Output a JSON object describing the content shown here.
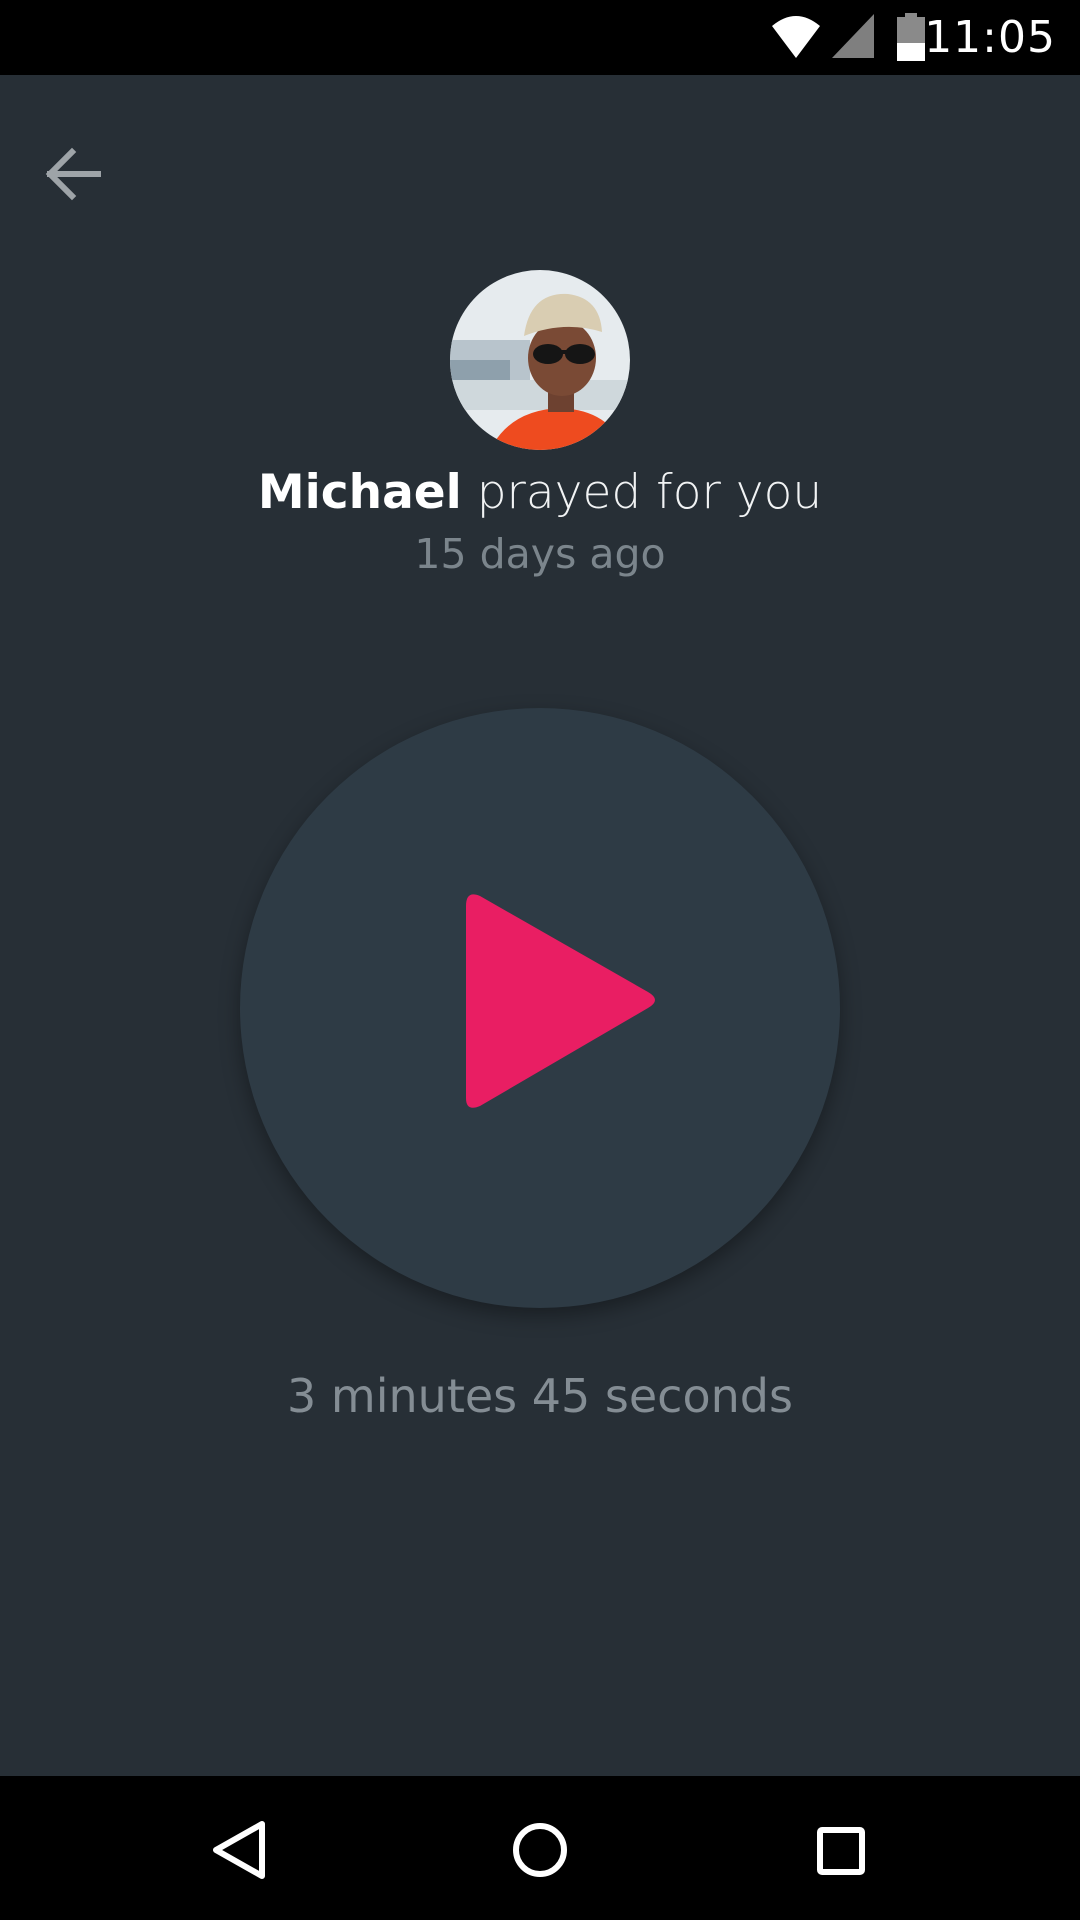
{
  "status_bar": {
    "time": "11:05",
    "icons": [
      "wifi-icon",
      "signal-icon",
      "battery-icon"
    ]
  },
  "toolbar": {
    "back_icon": "arrow-left-icon"
  },
  "prayer": {
    "name": "Michael",
    "action": " prayed for you",
    "time_ago": "15 days ago",
    "duration": "3 minutes 45 seconds"
  },
  "player": {
    "play_icon": "play-icon",
    "accent_color": "#e91e63"
  },
  "nav_bar": {
    "buttons": [
      "back-triangle-icon",
      "home-circle-icon",
      "recents-square-icon"
    ]
  }
}
